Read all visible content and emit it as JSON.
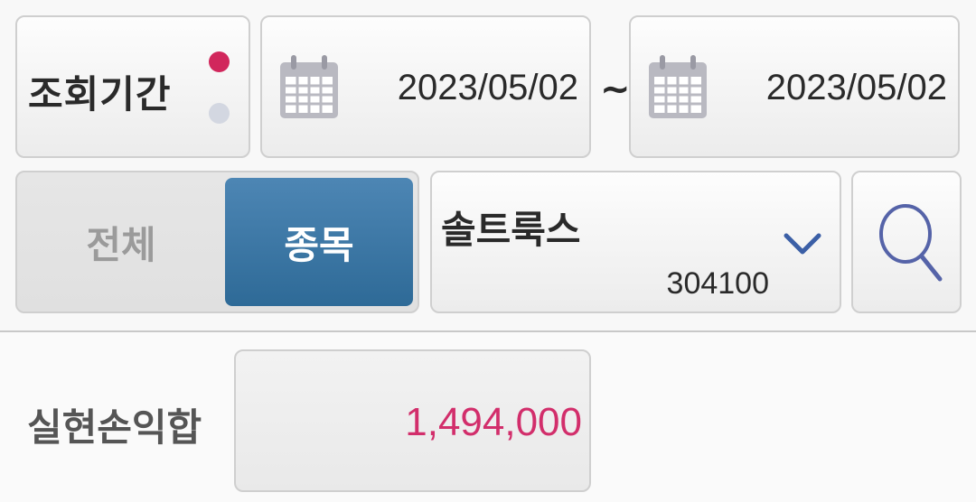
{
  "period": {
    "label": "조회기간",
    "start_date": "2023/05/02",
    "separator": "~",
    "end_date": "2023/05/02",
    "active_dot_color": "#d1275c",
    "inactive_dot_color": "#d3d7e1"
  },
  "scope_toggle": {
    "options": [
      {
        "label": "전체",
        "selected": false
      },
      {
        "label": "종목",
        "selected": true
      }
    ],
    "selected_color": "#3a78a6"
  },
  "stock": {
    "name": "솔트룩스",
    "code": "304100",
    "dropdown_icon": "chevron-down-icon"
  },
  "search": {
    "icon": "search-icon",
    "icon_color": "#5563a8"
  },
  "result": {
    "label": "실현손익합",
    "value": "1,494,000",
    "value_color": "#d22e6b"
  }
}
